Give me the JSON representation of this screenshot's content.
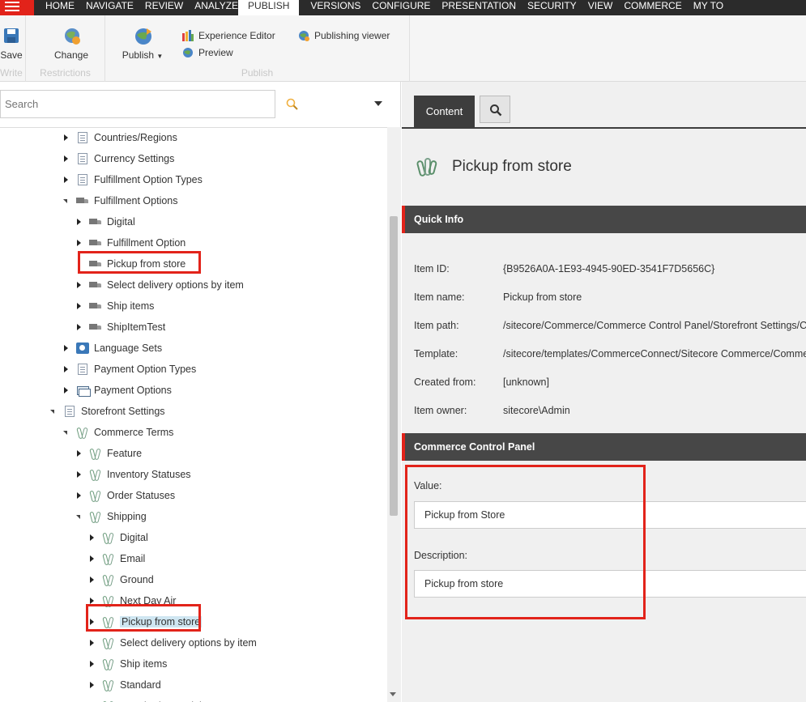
{
  "topnav": {
    "items": [
      "HOME",
      "NAVIGATE",
      "REVIEW",
      "ANALYZE",
      "PUBLISH",
      "VERSIONS",
      "CONFIGURE",
      "PRESENTATION",
      "SECURITY",
      "VIEW",
      "COMMERCE",
      "MY TO"
    ],
    "active_index": 4
  },
  "ribbon": {
    "save_label": "Save",
    "write_group": "Write",
    "change_label": "Change",
    "restrictions_group": "Restrictions",
    "publish_label": "Publish",
    "experience_editor_label": "Experience Editor",
    "preview_label": "Preview",
    "publishing_viewer_label": "Publishing viewer",
    "publish_group": "Publish"
  },
  "search": {
    "placeholder": "Search"
  },
  "tree": [
    {
      "label": "Countries/Regions",
      "icon": "page-icon",
      "state": "closed"
    },
    {
      "label": "Currency Settings",
      "icon": "page-icon",
      "state": "closed"
    },
    {
      "label": "Fulfillment Option Types",
      "icon": "page-icon",
      "state": "closed"
    },
    {
      "label": "Fulfillment Options",
      "icon": "truck-icon",
      "state": "open"
    },
    {
      "label": "Digital",
      "icon": "truck-icon",
      "state": "closed"
    },
    {
      "label": "Fulfillment Option",
      "icon": "truck-icon",
      "state": "closed"
    },
    {
      "label": "Pickup from store",
      "icon": "truck-icon",
      "state": "none"
    },
    {
      "label": "Select delivery options by item",
      "icon": "truck-icon",
      "state": "closed"
    },
    {
      "label": "Ship items",
      "icon": "truck-icon",
      "state": "closed"
    },
    {
      "label": "ShipItemTest",
      "icon": "truck-icon",
      "state": "closed"
    },
    {
      "label": "Language Sets",
      "icon": "globe-icon",
      "state": "closed"
    },
    {
      "label": "Payment Option Types",
      "icon": "page-icon",
      "state": "closed"
    },
    {
      "label": "Payment Options",
      "icon": "payment-icon",
      "state": "closed"
    },
    {
      "label": "Storefront Settings",
      "icon": "page-icon",
      "state": "open"
    },
    {
      "label": "Commerce Terms",
      "icon": "paperclip-icon",
      "state": "open"
    },
    {
      "label": "Feature",
      "icon": "paperclip-icon",
      "state": "closed"
    },
    {
      "label": "Inventory Statuses",
      "icon": "paperclip-icon",
      "state": "closed"
    },
    {
      "label": "Order Statuses",
      "icon": "paperclip-icon",
      "state": "closed"
    },
    {
      "label": "Shipping",
      "icon": "paperclip-icon",
      "state": "open"
    },
    {
      "label": "Digital",
      "icon": "paperclip-icon",
      "state": "closed"
    },
    {
      "label": "Email",
      "icon": "paperclip-icon",
      "state": "closed"
    },
    {
      "label": "Ground",
      "icon": "paperclip-icon",
      "state": "closed"
    },
    {
      "label": "Next Day Air",
      "icon": "paperclip-icon",
      "state": "closed"
    },
    {
      "label": "Pickup from store",
      "icon": "paperclip-icon",
      "state": "closed",
      "selected": true
    },
    {
      "label": "Select delivery options by item",
      "icon": "paperclip-icon",
      "state": "closed"
    },
    {
      "label": "Ship items",
      "icon": "paperclip-icon",
      "state": "closed"
    },
    {
      "label": "Standard",
      "icon": "paperclip-icon",
      "state": "closed"
    },
    {
      "label": "Standard Overnight",
      "icon": "paperclip-icon",
      "state": "closed"
    }
  ],
  "content": {
    "tab_label": "Content",
    "item_title": "Pickup from store",
    "quick_info_heading": "Quick Info",
    "quick_info": [
      {
        "key": "Item ID:",
        "value": "{B9526A0A-1E93-4945-90ED-3541F7D5656C}"
      },
      {
        "key": "Item name:",
        "value": "Pickup from store"
      },
      {
        "key": "Item path:",
        "value": "/sitecore/Commerce/Commerce Control Panel/Storefront Settings/Commerce Terms/Shipping/Pickup from store"
      },
      {
        "key": "Template:",
        "value": "/sitecore/templates/CommerceConnect/Sitecore Commerce/Commerce Control Panel"
      },
      {
        "key": "Created from:",
        "value": "[unknown]"
      },
      {
        "key": "Item owner:",
        "value": "sitecore\\Admin"
      }
    ],
    "ccp_heading": "Commerce Control Panel",
    "value_label": "Value:",
    "value_field": "Pickup from Store",
    "description_label": "Description:",
    "description_field": "Pickup from store"
  },
  "colors": {
    "accent": "#e2231a",
    "nav_bg": "#2b2b2b",
    "header_bg": "#474747"
  }
}
